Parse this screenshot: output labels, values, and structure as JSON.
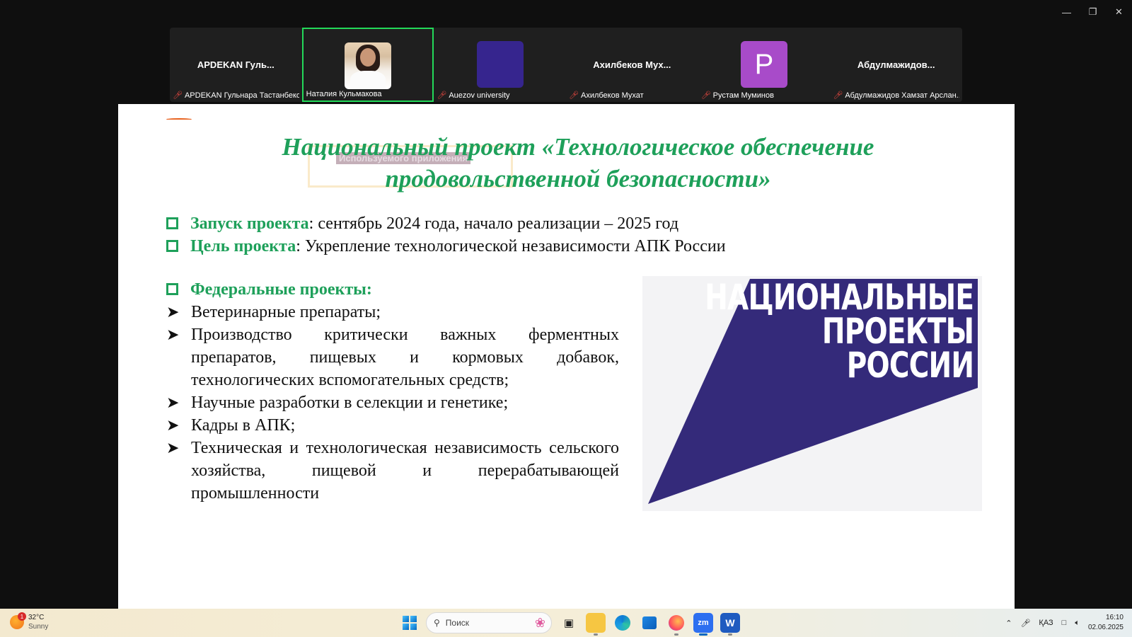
{
  "window": {
    "controls": [
      "minimize-icon",
      "restore-icon",
      "close-icon"
    ]
  },
  "participants": [
    {
      "display": "APDEKAN Гуль...",
      "label": "APDEKAN Гульнара Тастанбеко...",
      "avatar": "none",
      "muted": true,
      "active": false
    },
    {
      "display": "",
      "label": "Наталия Кульмакова",
      "avatar": "photo",
      "muted": false,
      "active": true
    },
    {
      "display": "",
      "label": "Auezov university",
      "avatar": "dark",
      "muted": true,
      "active": false
    },
    {
      "display": "Ахилбеков Мух...",
      "label": "Ахилбеков Мухат",
      "avatar": "none",
      "muted": true,
      "active": false
    },
    {
      "display": "P",
      "label": "Рустам Муминов",
      "avatar": "letter",
      "muted": true,
      "active": false
    },
    {
      "display": "Абдулмажидов...",
      "label": "Абдулмажидов Хамзат Арслан...",
      "avatar": "none",
      "muted": true,
      "active": false
    }
  ],
  "slide": {
    "title_line1": "Национальный проект «Технологическое обеспечение",
    "title_line2": "продовольственной безопасности»",
    "ghost_label": "Используемого приложения",
    "launch_label": "Запуск проекта",
    "launch_text": ": сентябрь 2024 года, начало реализации – 2025 год",
    "goal_label": "Цель проекта",
    "goal_text": ": Укрепление технологической независимости АПК России",
    "federal_label": "Федеральные проекты:",
    "federal_items": [
      " Ветеринарные препараты;",
      " Производство критически важных ферментных препаратов, пищевых и кормовых добавок, технологических вспомогательных средств;",
      "Научные разработки в селекции и генетике;",
      "Кадры в АПК;",
      "Техническая и технологическая независимость сельского хозяйства, пищевой и перерабатывающей промышленности"
    ],
    "logo_line1": "НАЦИОНАЛЬНЫЕ",
    "logo_line2": "ПРОЕКТЫ",
    "logo_line3": "РОССИИ",
    "logo_color": "#342a7a",
    "accent_color": "#1ea05a"
  },
  "taskbar": {
    "weather_temp": "32°C",
    "weather_desc": "Sunny",
    "weather_badge": "1",
    "search_placeholder": "Поиск",
    "apps": [
      "task-view-icon",
      "file-explorer-icon",
      "edge-icon",
      "store-icon",
      "firefox-icon",
      "zoom-icon",
      "word-icon"
    ],
    "zoom_label": "zm",
    "word_label": "W",
    "language": "ҚАЗ",
    "time": "16:10",
    "date": "02.06.2025"
  }
}
